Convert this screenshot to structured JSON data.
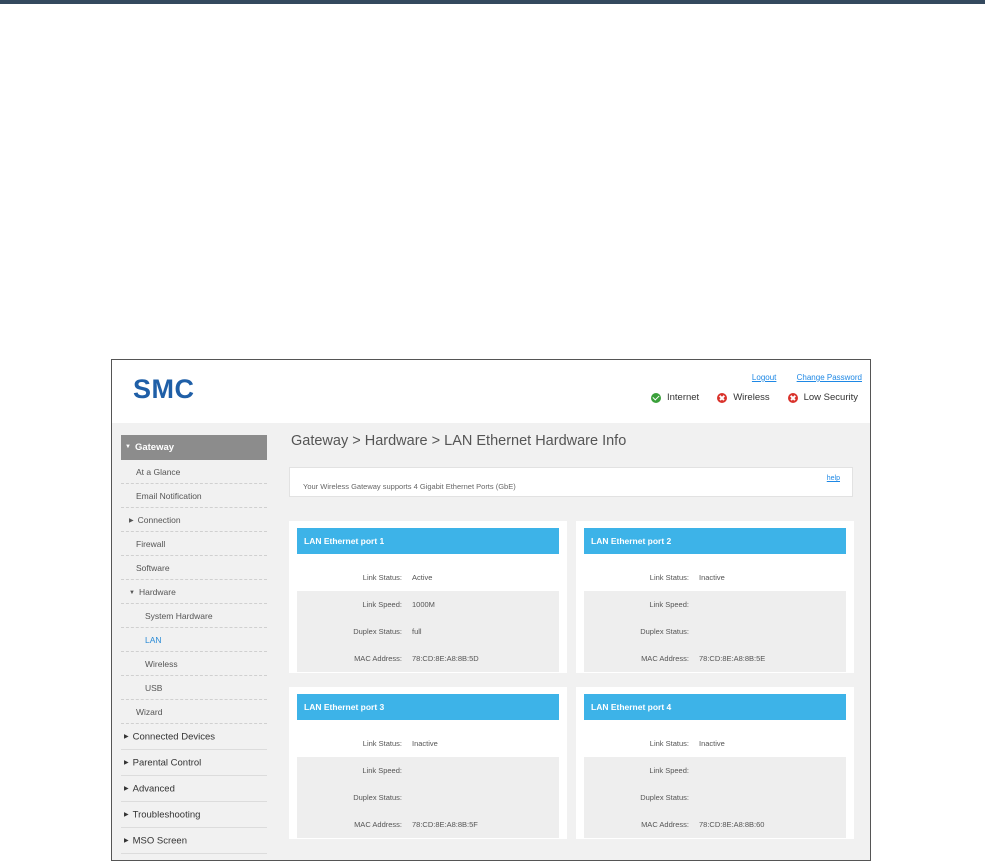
{
  "brand": {
    "logo": "SMC"
  },
  "header_links": {
    "logout": "Logout",
    "change_password": "Change Password"
  },
  "status": [
    {
      "label": "Internet",
      "state": "ok"
    },
    {
      "label": "Wireless",
      "state": "error"
    },
    {
      "label": "Low Security",
      "state": "error"
    }
  ],
  "sidebar": {
    "section": "Gateway",
    "items": [
      "At a Glance",
      "Email Notification",
      "Connection",
      "Firewall",
      "Software",
      "Hardware",
      "System Hardware",
      "LAN",
      "Wireless",
      "USB",
      "Wizard"
    ],
    "main_items": [
      "Connected Devices",
      "Parental Control",
      "Advanced",
      "Troubleshooting",
      "MSO Screen"
    ]
  },
  "page": {
    "title": "Gateway > Hardware > LAN Ethernet Hardware Info",
    "info": "Your Wireless Gateway supports 4 Gigabit Ethernet Ports (GbE)",
    "help": "help"
  },
  "labels": {
    "link_status": "Link Status:",
    "link_speed": "Link Speed:",
    "duplex_status": "Duplex Status:",
    "mac_address": "MAC Address:"
  },
  "ports": [
    {
      "title": "LAN Ethernet port 1",
      "link_status": "Active",
      "link_speed": "1000M",
      "duplex_status": "full",
      "mac": "78:CD:8E:A8:8B:5D"
    },
    {
      "title": "LAN Ethernet port 2",
      "link_status": "Inactive",
      "link_speed": "",
      "duplex_status": "",
      "mac": "78:CD:8E:A8:8B:5E"
    },
    {
      "title": "LAN Ethernet port 3",
      "link_status": "Inactive",
      "link_speed": "",
      "duplex_status": "",
      "mac": "78:CD:8E:A8:8B:5F"
    },
    {
      "title": "LAN Ethernet port 4",
      "link_status": "Inactive",
      "link_speed": "",
      "duplex_status": "",
      "mac": "78:CD:8E:A8:8B:60"
    }
  ],
  "colors": {
    "brand": "#1f5fa7",
    "port_header": "#3db3e8",
    "nav_active": "#8c8c8c",
    "link": "#1e88e5"
  }
}
